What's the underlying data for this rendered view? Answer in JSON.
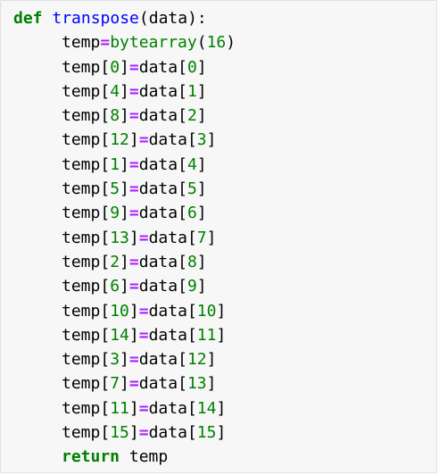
{
  "code": {
    "def_keyword": "def",
    "func_name": "transpose",
    "signature_rest": "(data):",
    "init_var": "temp",
    "init_op": "=",
    "init_builtin": "bytearray",
    "init_open": "(",
    "init_num": "16",
    "init_close": ")",
    "assignments": [
      {
        "lhs": "temp",
        "lhs_idx": "0",
        "rhs": "data",
        "rhs_idx": "0"
      },
      {
        "lhs": "temp",
        "lhs_idx": "4",
        "rhs": "data",
        "rhs_idx": "1"
      },
      {
        "lhs": "temp",
        "lhs_idx": "8",
        "rhs": "data",
        "rhs_idx": "2"
      },
      {
        "lhs": "temp",
        "lhs_idx": "12",
        "rhs": "data",
        "rhs_idx": "3"
      },
      {
        "lhs": "temp",
        "lhs_idx": "1",
        "rhs": "data",
        "rhs_idx": "4"
      },
      {
        "lhs": "temp",
        "lhs_idx": "5",
        "rhs": "data",
        "rhs_idx": "5"
      },
      {
        "lhs": "temp",
        "lhs_idx": "9",
        "rhs": "data",
        "rhs_idx": "6"
      },
      {
        "lhs": "temp",
        "lhs_idx": "13",
        "rhs": "data",
        "rhs_idx": "7"
      },
      {
        "lhs": "temp",
        "lhs_idx": "2",
        "rhs": "data",
        "rhs_idx": "8"
      },
      {
        "lhs": "temp",
        "lhs_idx": "6",
        "rhs": "data",
        "rhs_idx": "9"
      },
      {
        "lhs": "temp",
        "lhs_idx": "10",
        "rhs": "data",
        "rhs_idx": "10"
      },
      {
        "lhs": "temp",
        "lhs_idx": "14",
        "rhs": "data",
        "rhs_idx": "11"
      },
      {
        "lhs": "temp",
        "lhs_idx": "3",
        "rhs": "data",
        "rhs_idx": "12"
      },
      {
        "lhs": "temp",
        "lhs_idx": "7",
        "rhs": "data",
        "rhs_idx": "13"
      },
      {
        "lhs": "temp",
        "lhs_idx": "11",
        "rhs": "data",
        "rhs_idx": "14"
      },
      {
        "lhs": "temp",
        "lhs_idx": "15",
        "rhs": "data",
        "rhs_idx": "15"
      }
    ],
    "return_keyword": "return",
    "return_value": "temp"
  },
  "colors": {
    "keyword": "#008000",
    "function_name": "#0000ff",
    "operator": "#aa22ff",
    "number": "#008000",
    "cell_background": "#f7f7f7",
    "cell_border": "#e0e0e0"
  }
}
